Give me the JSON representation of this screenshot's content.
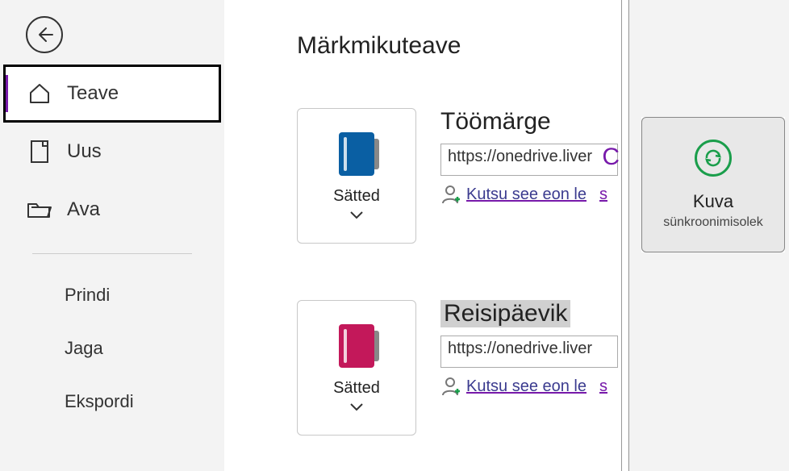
{
  "sidebar": {
    "primary": [
      {
        "label": "Teave",
        "selected": true
      },
      {
        "label": "Uus",
        "selected": false
      },
      {
        "label": "Ava",
        "selected": false
      }
    ],
    "secondary": [
      {
        "label": "Prindi"
      },
      {
        "label": "Jaga"
      },
      {
        "label": "Ekspordi"
      }
    ]
  },
  "main": {
    "heading": "Märkmikuteave",
    "settings_label": "Sätted",
    "notebooks": [
      {
        "title": "Töömärge",
        "color": "#0a5fa3",
        "url": "https://onedrive.liver",
        "invite_text": "Kutsu see eon le",
        "trailing": "s",
        "top_right": "C",
        "selected": false
      },
      {
        "title": "Reisipäevik",
        "color": "#c3185a",
        "url": "https://onedrive.liver",
        "invite_text": "Kutsu see eon le",
        "trailing": "s",
        "top_right": "",
        "selected": true
      }
    ]
  },
  "right": {
    "sync_title": "Kuva",
    "sync_sub": "sünkroonimisolek"
  }
}
